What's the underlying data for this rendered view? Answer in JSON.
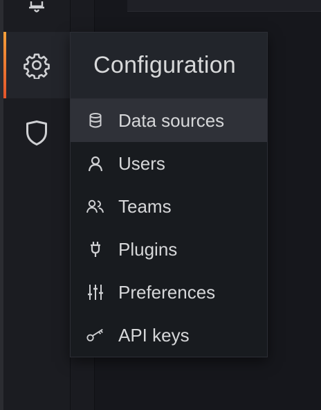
{
  "sidenav": {
    "items": [
      {
        "icon": "bell-icon"
      },
      {
        "icon": "gear-icon",
        "active": true
      },
      {
        "icon": "shield-icon"
      }
    ],
    "accent_color": "#f05a28"
  },
  "menu": {
    "title": "Configuration",
    "items": [
      {
        "label": "Data sources",
        "icon": "database-icon",
        "active": true
      },
      {
        "label": "Users",
        "icon": "user-icon"
      },
      {
        "label": "Teams",
        "icon": "users-icon"
      },
      {
        "label": "Plugins",
        "icon": "plug-icon"
      },
      {
        "label": "Preferences",
        "icon": "sliders-icon"
      },
      {
        "label": "API keys",
        "icon": "key-icon"
      }
    ]
  }
}
